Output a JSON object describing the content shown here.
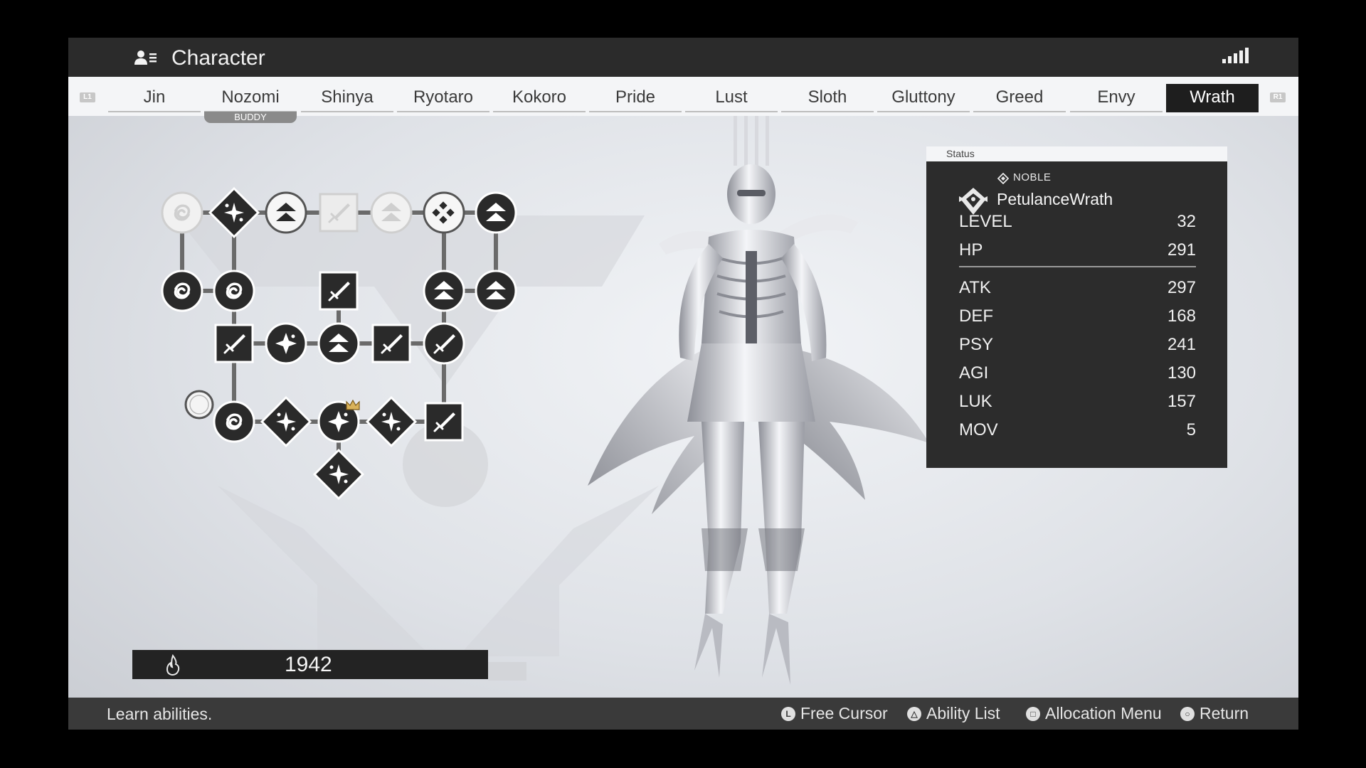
{
  "header": {
    "title": "Character"
  },
  "tabs": {
    "l1_label": "L1",
    "r1_label": "R1",
    "items": [
      "Jin",
      "Nozomi",
      "Shinya",
      "Ryotaro",
      "Kokoro",
      "Pride",
      "Lust",
      "Sloth",
      "Gluttony",
      "Greed",
      "Envy",
      "Wrath"
    ],
    "active": "Wrath",
    "buddy_badge": "BUDDY"
  },
  "status": {
    "header": "Status",
    "race": "NOBLE",
    "name": "PetulanceWrath",
    "level_label": "LEVEL",
    "level": "32",
    "hp_label": "HP",
    "hp": "291",
    "atk_label": "ATK",
    "atk": "297",
    "def_label": "DEF",
    "def": "168",
    "psy_label": "PSY",
    "psy": "241",
    "agi_label": "AGI",
    "agi": "130",
    "luk_label": "LUK",
    "luk": "157",
    "mov_label": "MOV",
    "mov": "5"
  },
  "points": {
    "value": "1942",
    "icon": "flame-icon"
  },
  "footer": {
    "hint": "Learn abilities.",
    "controls": [
      {
        "glyph": "L",
        "label": "Free Cursor"
      },
      {
        "glyph": "△",
        "label": "Ability List"
      },
      {
        "glyph": "□",
        "label": "Allocation Menu"
      },
      {
        "glyph": "○",
        "label": "Return"
      }
    ]
  },
  "colors": {
    "panel": "#2c2c2c",
    "active_tab": "#1e1e1e",
    "node_dark": "#2a2a2a",
    "crown": "#d9b25a"
  }
}
